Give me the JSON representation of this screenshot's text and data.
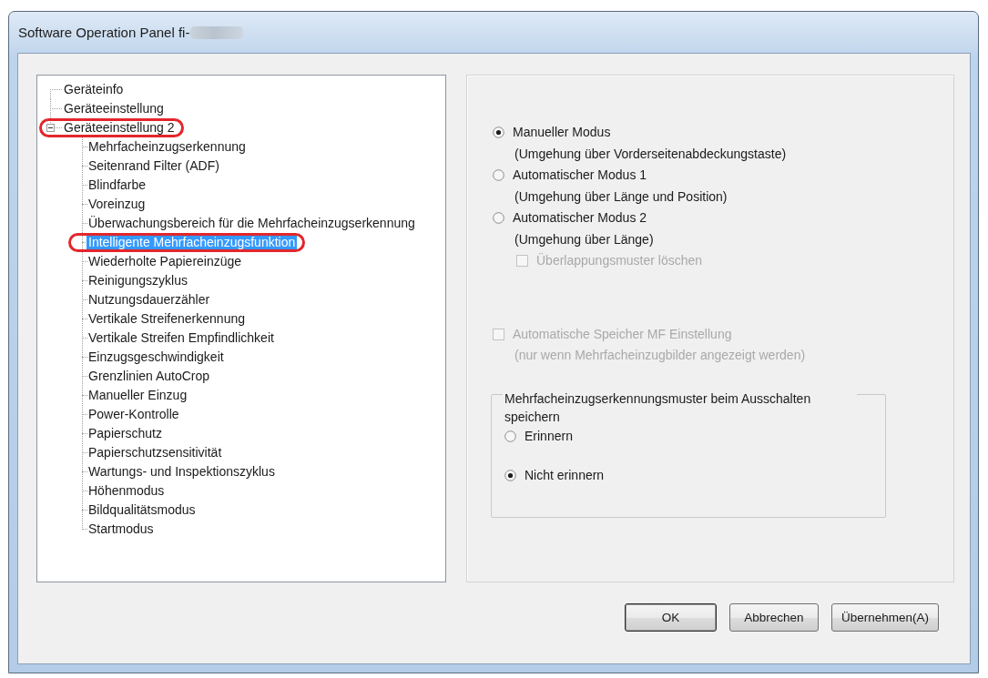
{
  "window": {
    "title": "Software Operation Panel fi-",
    "title_redacted": true
  },
  "tree": {
    "items": [
      {
        "label": "Geräteinfo",
        "selected": false,
        "annotated": false
      },
      {
        "label": "Geräteeinstellung",
        "selected": false,
        "annotated": false
      },
      {
        "label": "Geräteeinstellung 2",
        "selected": false,
        "annotated": true,
        "expanded": true,
        "children": [
          {
            "label": "Mehrfacheinzugserkennung",
            "selected": false,
            "annotated": false
          },
          {
            "label": "Seitenrand Filter (ADF)",
            "selected": false,
            "annotated": false
          },
          {
            "label": "Blindfarbe",
            "selected": false,
            "annotated": false
          },
          {
            "label": "Voreinzug",
            "selected": false,
            "annotated": false
          },
          {
            "label": "Überwachungsbereich für die Mehrfacheinzugserkennung",
            "selected": false,
            "annotated": false
          },
          {
            "label": "Intelligente Mehrfacheinzugsfunktion",
            "selected": true,
            "annotated": true
          },
          {
            "label": "Wiederholte Papiereinzüge",
            "selected": false,
            "annotated": false
          },
          {
            "label": "Reinigungszyklus",
            "selected": false,
            "annotated": false
          },
          {
            "label": "Nutzungsdauerzähler",
            "selected": false,
            "annotated": false
          },
          {
            "label": "Vertikale Streifenerkennung",
            "selected": false,
            "annotated": false
          },
          {
            "label": "Vertikale Streifen Empfindlichkeit",
            "selected": false,
            "annotated": false
          },
          {
            "label": "Einzugsgeschwindigkeit",
            "selected": false,
            "annotated": false
          },
          {
            "label": "Grenzlinien AutoCrop",
            "selected": false,
            "annotated": false
          },
          {
            "label": "Manueller Einzug",
            "selected": false,
            "annotated": false
          },
          {
            "label": "Power-Kontrolle",
            "selected": false,
            "annotated": false
          },
          {
            "label": "Papierschutz",
            "selected": false,
            "annotated": false
          },
          {
            "label": "Papierschutzsensitivität",
            "selected": false,
            "annotated": false
          },
          {
            "label": "Wartungs- und Inspektionszyklus",
            "selected": false,
            "annotated": false
          },
          {
            "label": "Höhenmodus",
            "selected": false,
            "annotated": false
          },
          {
            "label": "Bildqualitätsmodus",
            "selected": false,
            "annotated": false
          },
          {
            "label": "Startmodus",
            "selected": false,
            "annotated": false
          }
        ]
      }
    ]
  },
  "settings": {
    "modes": [
      {
        "label": "Manueller Modus",
        "note": "(Umgehung über Vorderseitenabdeckungstaste)",
        "selected": true
      },
      {
        "label": "Automatischer Modus 1",
        "note": "(Umgehung über Länge und Position)",
        "selected": false
      },
      {
        "label": "Automatischer Modus 2",
        "note": "(Umgehung über Länge)",
        "selected": false
      }
    ],
    "overlap_checkbox": {
      "label": "Überlappungsmuster löschen",
      "checked": false,
      "disabled": true
    },
    "auto_memory_checkbox": {
      "label": "Automatische Speicher MF Einstellung",
      "note": "(nur wenn Mehrfacheinzugbilder angezeigt werden)",
      "checked": false,
      "disabled": true
    },
    "remember_group": {
      "title": "Mehrfacheinzugserkennungsmuster beim Ausschalten speichern",
      "options": [
        {
          "label": "Erinnern",
          "selected": false
        },
        {
          "label": "Nicht erinnern",
          "selected": true
        }
      ]
    }
  },
  "buttons": [
    {
      "label": "OK",
      "default": true
    },
    {
      "label": "Abbrechen",
      "default": false
    },
    {
      "label": "Übernehmen(A)",
      "default": false
    }
  ]
}
